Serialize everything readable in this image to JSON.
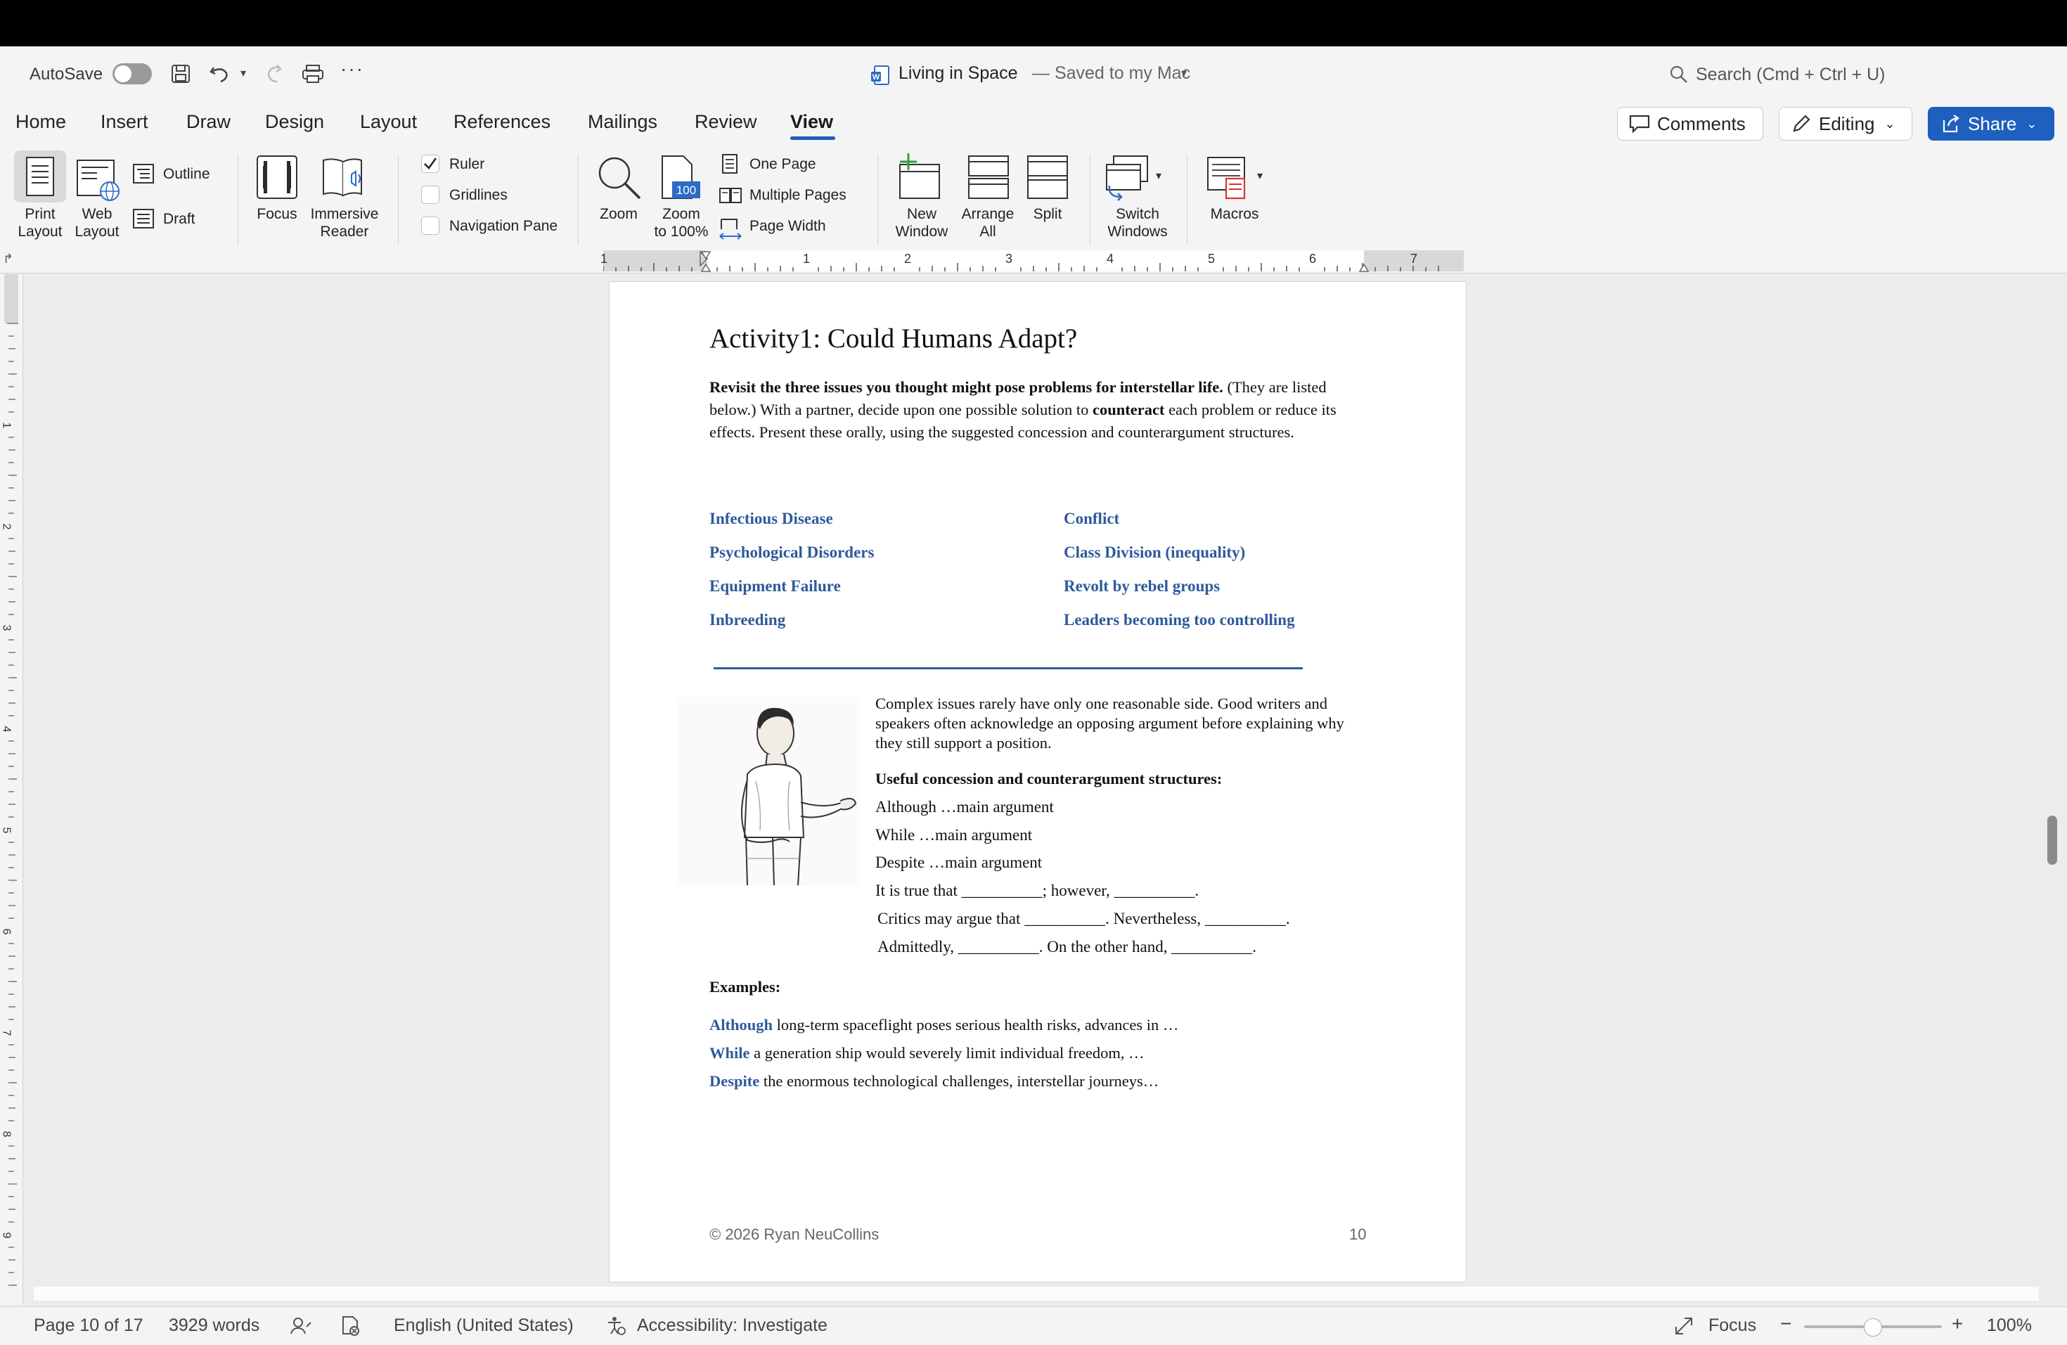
{
  "title_bar": {
    "autosave_label": "AutoSave",
    "document_title": "Living in Space",
    "save_status": "— Saved to my Mac",
    "search_placeholder": "Search (Cmd + Ctrl + U)"
  },
  "ribbon_tabs": [
    "Home",
    "Insert",
    "Draw",
    "Design",
    "Layout",
    "References",
    "Mailings",
    "Review",
    "View"
  ],
  "active_tab": "View",
  "header_buttons": {
    "comments": "Comments",
    "editing": "Editing",
    "share": "Share"
  },
  "ribbon": {
    "print_layout": [
      "Print",
      "Layout"
    ],
    "web_layout": [
      "Web",
      "Layout"
    ],
    "outline": "Outline",
    "draft": "Draft",
    "focus": "Focus",
    "immersive_reader": [
      "Immersive",
      "Reader"
    ],
    "ruler": "Ruler",
    "ruler_checked": true,
    "gridlines": "Gridlines",
    "navigation_pane": "Navigation Pane",
    "zoom": "Zoom",
    "zoom_100": [
      "Zoom",
      "to 100%"
    ],
    "zoom_100_icon_text": "100",
    "one_page": "One Page",
    "multiple_pages": "Multiple Pages",
    "page_width": "Page Width",
    "new_window": [
      "New",
      "Window"
    ],
    "arrange_all": [
      "Arrange",
      "All"
    ],
    "split": "Split",
    "switch_windows": [
      "Switch",
      "Windows"
    ],
    "macros": "Macros"
  },
  "ruler_numbers": [
    "1",
    "1",
    "2",
    "3",
    "4",
    "5",
    "6",
    "7"
  ],
  "vruler_numbers": [
    "1",
    "2",
    "3",
    "4",
    "5",
    "6",
    "7",
    "8",
    "9"
  ],
  "document": {
    "heading": "Activity1: Could Humans Adapt?",
    "intro_bold": "Revisit the three issues you thought might pose problems for interstellar life.",
    "intro_rest_1": " (They are listed below.) With a partner, decide upon one possible solution to ",
    "intro_bold_2": "counteract",
    "intro_rest_2": " each problem or reduce its effects. Present these orally, using the suggested concession and counterargument structures.",
    "issues_left": [
      "Infectious Disease",
      "Psychological Disorders",
      "Equipment Failure",
      "Inbreeding"
    ],
    "issues_right": [
      "Conflict",
      "Class Division (inequality)",
      "Revolt by rebel groups",
      "Leaders becoming too controlling"
    ],
    "side_paragraph": "Complex issues rarely have only one reasonable side. Good writers and speakers often acknowledge an opposing argument before explaining why they still support a position.",
    "structures_heading": "Useful concession and counterargument structures:",
    "structures": [
      "Although …main argument",
      "While …main argument",
      "Despite …main argument",
      "It is true that __________; however, __________.",
      "Critics may argue that __________. Nevertheless, __________.",
      "Admittedly, __________. On the other hand, __________."
    ],
    "examples_heading": "Examples:",
    "examples": [
      {
        "lead": "Although",
        "rest": " long-term spaceflight poses serious health risks, advances in …"
      },
      {
        "lead": "While",
        "rest": " a generation ship would severely limit individual freedom, …"
      },
      {
        "lead": "Despite",
        "rest": " the enormous technological challenges, interstellar journeys…"
      }
    ],
    "footer_copyright": "© 2026 Ryan NeuCollins",
    "footer_page": "10"
  },
  "status_bar": {
    "page": "Page 10 of 17",
    "words": "3929 words",
    "language": "English (United States)",
    "accessibility": "Accessibility: Investigate",
    "focus": "Focus",
    "zoom_level": "100%",
    "zoom_slider_fraction": 0.5
  },
  "colors": {
    "accent_blue": "#1f5fbf",
    "doc_blue": "#2e5a9b",
    "share_button": "#1f5fbf"
  }
}
